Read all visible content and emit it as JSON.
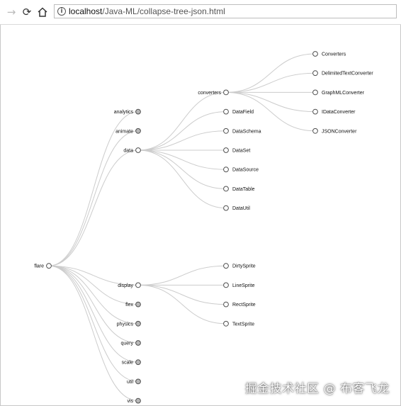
{
  "browser": {
    "url_host": "localhost",
    "url_path": "/Java-ML/collapse-tree-json.html",
    "back_icon": "back-arrow-icon",
    "reload_icon": "reload-icon",
    "home_icon": "home-icon",
    "info_icon": "info-icon"
  },
  "tree": {
    "colors": {
      "expanded_fill": "#ffffff",
      "collapsed_fill": "#b8b8b8",
      "link": "#cccccc"
    },
    "root": {
      "name": "flare",
      "children": [
        {
          "name": "analytics",
          "collapsed": true
        },
        {
          "name": "animate",
          "collapsed": true
        },
        {
          "name": "data",
          "children": [
            {
              "name": "converters",
              "children": [
                {
                  "name": "Converters"
                },
                {
                  "name": "DelimitedTextConverter"
                },
                {
                  "name": "GraphMLConverter"
                },
                {
                  "name": "IDataConverter"
                },
                {
                  "name": "JSONConverter"
                }
              ]
            },
            {
              "name": "DataField"
            },
            {
              "name": "DataSchema"
            },
            {
              "name": "DataSet"
            },
            {
              "name": "DataSource"
            },
            {
              "name": "DataTable"
            },
            {
              "name": "DataUtil"
            }
          ]
        },
        {
          "name": "display",
          "children": [
            {
              "name": "DirtySprite"
            },
            {
              "name": "LineSprite"
            },
            {
              "name": "RectSprite"
            },
            {
              "name": "TextSprite"
            }
          ]
        },
        {
          "name": "flex",
          "collapsed": true
        },
        {
          "name": "physics",
          "collapsed": true
        },
        {
          "name": "query",
          "collapsed": true
        },
        {
          "name": "scale",
          "collapsed": true
        },
        {
          "name": "util",
          "collapsed": true
        },
        {
          "name": "vis",
          "collapsed": true
        }
      ]
    }
  },
  "watermark": "掘金技术社区 @ 布客飞龙"
}
